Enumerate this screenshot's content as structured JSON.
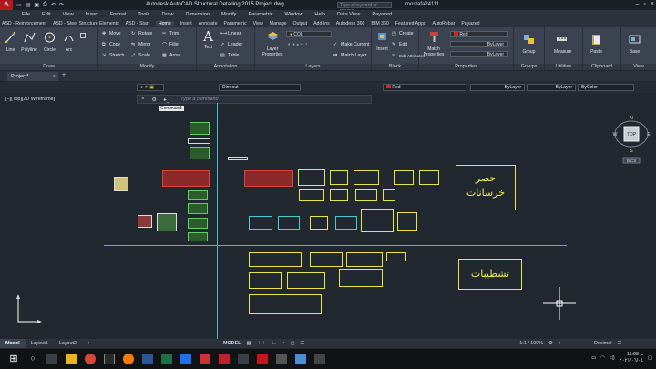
{
  "titlebar": {
    "app_title": "Autodesk AutoCAD Structural Detailing 2015   Project.dwg",
    "search_placeholder": "Type a keyword or phrase",
    "user": "mostafa24111...",
    "logo": "A"
  },
  "menubar": [
    "File",
    "Edit",
    "View",
    "Insert",
    "Format",
    "Tools",
    "Draw",
    "Dimension",
    "Modify",
    "Parametric",
    "Window",
    "Help",
    "Data View",
    "Payazed"
  ],
  "ribbon_tabs": [
    "ASD - Reinforcement",
    "ASD - Steel Structure Elements",
    "ASD - Start",
    "Home",
    "Insert",
    "Annotate",
    "Parametric",
    "View",
    "Manage",
    "Output",
    "Add-ins",
    "Autodesk 360",
    "BIM 360",
    "Featured Apps",
    "AutoRebar",
    "Payazed"
  ],
  "active_ribbon_tab": "Home",
  "ribbon": {
    "draw": {
      "title": "Draw",
      "buttons": [
        "Line",
        "Polyline",
        "Circle",
        "Arc"
      ]
    },
    "modify": {
      "title": "Modify",
      "rows": [
        [
          "Move",
          "Rotate",
          "Trim"
        ],
        [
          "Copy",
          "Mirror",
          "Fillet"
        ],
        [
          "Stretch",
          "Scale",
          "Array"
        ]
      ]
    },
    "annotation": {
      "title": "Annotation",
      "text": "Text",
      "items": [
        "Linear",
        "Leader",
        "Table"
      ]
    },
    "layers": {
      "title": "Layers",
      "props": "Layer Properties",
      "combo": "COL",
      "items": [
        "Make Current",
        "Match Layer"
      ]
    },
    "block": {
      "title": "Block",
      "insert": "Insert",
      "items": [
        "Create",
        "Edit",
        "Edit Attributes"
      ]
    },
    "properties": {
      "title": "Properties",
      "match": "Match Properties",
      "color": "Red",
      "linetype": "ByLayer",
      "lineweight": "ByLayer"
    },
    "groups": {
      "title": "Groups",
      "label": "Group"
    },
    "utilities": {
      "title": "Utilities",
      "label": "Measure"
    },
    "clipboard": {
      "title": "Clipboard",
      "label": "Paste"
    },
    "view": {
      "title": "View",
      "label": "Base"
    }
  },
  "doc_tab": "Project*",
  "propbar": {
    "dim": "Dim-out",
    "color": "Red",
    "linetype": "ByLayer",
    "lineweight": "ByLayer",
    "plotstyle": "ByColor"
  },
  "drawing": {
    "view_label": "[−][Top][2D Wireframe]",
    "command_placeholder": "Type a command",
    "command_tip": "Command:",
    "label_concrete": "حصر خرسانات",
    "label_finishes": "تشطيبات"
  },
  "viewcube": {
    "face": "TOP",
    "n": "N",
    "s": "S",
    "e": "E",
    "w": "W",
    "wcs": "WCS"
  },
  "layout_tabs": [
    "Model",
    "Layout1",
    "Layout2"
  ],
  "status": {
    "model": "MODEL",
    "scale": "1:1 / 100%",
    "units": "Decimal"
  },
  "clock": {
    "time": "11:08 م",
    "date": "٢٠٢١/٠٦/٠٤"
  },
  "colors": {
    "accent_cyan": "#37c0d3",
    "block_yellow": "#e9e44c",
    "bg": "#212830"
  }
}
